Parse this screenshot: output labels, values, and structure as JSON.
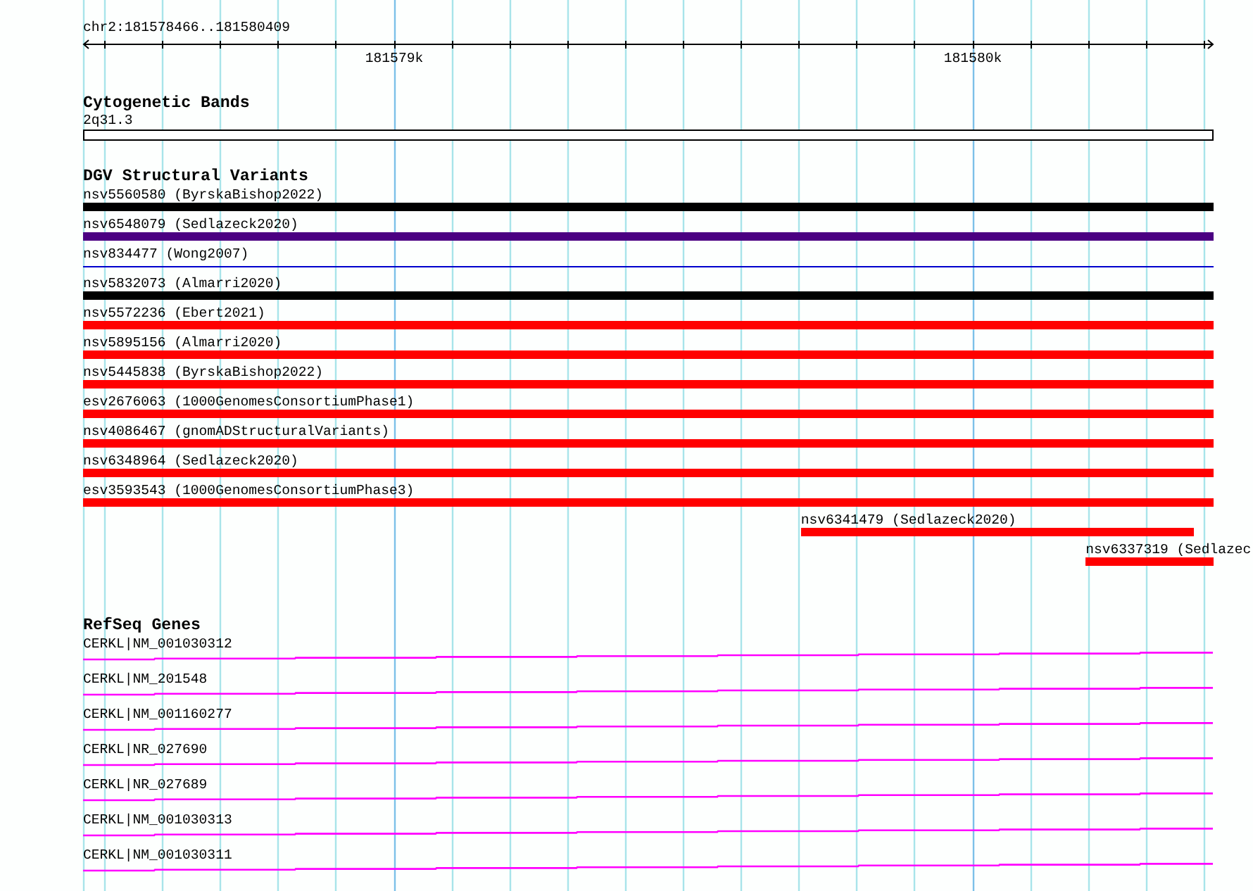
{
  "ruler": {
    "location": "chr2:181578466..181580409",
    "ticks": [
      "181579k",
      "181580k"
    ]
  },
  "cytogenetic_bands": {
    "title": "Cytogenetic Bands",
    "bands": [
      {
        "label": "2q31.3"
      }
    ]
  },
  "dgv_structural_variants": {
    "title": "DGV Structural Variants",
    "variants": [
      {
        "label": "nsv5560580 (ByrskaBishop2022)",
        "color": "#000000",
        "kind": "bar"
      },
      {
        "label": "nsv6548079 (Sedlazeck2020)",
        "color": "#4b0082",
        "kind": "bar"
      },
      {
        "label": "nsv834477 (Wong2007)",
        "color": "#0000cc",
        "kind": "line"
      },
      {
        "label": "nsv5832073 (Almarri2020)",
        "color": "#000000",
        "kind": "bar"
      },
      {
        "label": "nsv5572236 (Ebert2021)",
        "color": "#ff0000",
        "kind": "bar"
      },
      {
        "label": "nsv5895156 (Almarri2020)",
        "color": "#ff0000",
        "kind": "bar"
      },
      {
        "label": "nsv5445838 (ByrskaBishop2022)",
        "color": "#ff0000",
        "kind": "bar"
      },
      {
        "label": "esv2676063 (1000GenomesConsortiumPhase1)",
        "color": "#ff0000",
        "kind": "bar"
      },
      {
        "label": "nsv4086467 (gnomADStructuralVariants)",
        "color": "#ff0000",
        "kind": "bar"
      },
      {
        "label": "nsv6348964 (Sedlazeck2020)",
        "color": "#ff0000",
        "kind": "bar"
      },
      {
        "label": "esv3593543 (1000GenomesConsortiumPhase3)",
        "color": "#ff0000",
        "kind": "bar"
      },
      {
        "label": "nsv6341479 (Sedlazeck2020)",
        "color": "#ff0000",
        "kind": "bar"
      },
      {
        "label": "nsv6337319 (Sedlazec",
        "color": "#ff0000",
        "kind": "bar"
      }
    ]
  },
  "refseq_genes": {
    "title": "RefSeq Genes",
    "genes": [
      {
        "label": "CERKL|NM_001030312"
      },
      {
        "label": "CERKL|NM_201548"
      },
      {
        "label": "CERKL|NM_001160277"
      },
      {
        "label": "CERKL|NR_027690"
      },
      {
        "label": "CERKL|NR_027689"
      },
      {
        "label": "CERKL|NM_001030313"
      },
      {
        "label": "CERKL|NM_001030311"
      }
    ]
  }
}
